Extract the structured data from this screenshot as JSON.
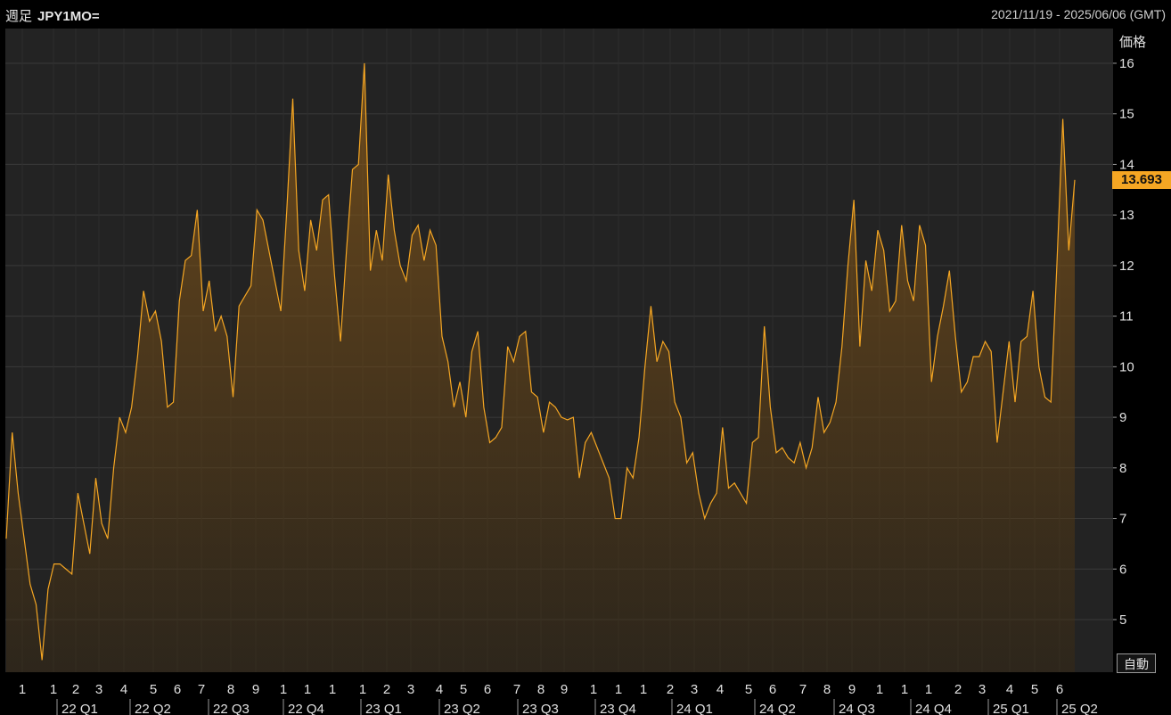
{
  "header": {
    "freq_label": "週足",
    "symbol": "JPY1MO=",
    "date_range": "2021/11/19 - 2025/06/06 (GMT)"
  },
  "price_axis_label": "価格",
  "auto_button": "自動",
  "last_value_badge": "13.693",
  "colors": {
    "line": "#f5a623",
    "background": "#232323",
    "grid": "#3a3a3a",
    "badge": "#f5a623"
  },
  "chart_data": {
    "type": "area",
    "ylim": [
      4.0,
      16.5
    ],
    "y_ticks": [
      5,
      6,
      7,
      8,
      9,
      10,
      11,
      12,
      13,
      14,
      15,
      16
    ],
    "last_value": 13.693,
    "x_month_ticks": [
      "1",
      "1",
      "2",
      "3",
      "4",
      "5",
      "6",
      "7",
      "8",
      "9",
      "1",
      "1",
      "1",
      "1",
      "2",
      "3",
      "4",
      "5",
      "6",
      "7",
      "8",
      "9",
      "1",
      "1",
      "1",
      "2",
      "3",
      "4",
      "5",
      "6",
      "7",
      "8",
      "9",
      "1",
      "1",
      "1",
      "2",
      "3",
      "4",
      "5",
      "6"
    ],
    "quarter_labels": [
      "22 Q1",
      "22 Q2",
      "22 Q3",
      "22 Q4",
      "23 Q1",
      "23 Q2",
      "23 Q3",
      "23 Q4",
      "24 Q1",
      "24 Q2",
      "24 Q3",
      "24 Q4",
      "25 Q1",
      "25 Q2"
    ],
    "values": [
      6.6,
      8.7,
      7.5,
      6.6,
      5.7,
      5.3,
      4.2,
      5.6,
      6.1,
      6.1,
      6.0,
      5.9,
      7.5,
      6.9,
      6.3,
      7.8,
      6.9,
      6.6,
      8.0,
      9.0,
      8.7,
      9.2,
      10.2,
      11.5,
      10.9,
      11.1,
      10.5,
      9.2,
      9.3,
      11.3,
      12.1,
      12.2,
      13.1,
      11.1,
      11.7,
      10.7,
      11.0,
      10.6,
      9.4,
      11.2,
      11.4,
      11.6,
      13.1,
      12.9,
      12.3,
      11.7,
      11.1,
      13.1,
      15.3,
      12.3,
      11.5,
      12.9,
      12.3,
      13.3,
      13.4,
      11.8,
      10.5,
      12.3,
      13.9,
      14.0,
      16.0,
      11.9,
      12.7,
      12.1,
      13.8,
      12.7,
      12.0,
      11.7,
      12.6,
      12.8,
      12.1,
      12.7,
      12.4,
      10.6,
      10.1,
      9.2,
      9.7,
      9.0,
      10.3,
      10.7,
      9.2,
      8.5,
      8.6,
      8.8,
      10.4,
      10.1,
      10.6,
      10.7,
      9.5,
      9.4,
      8.7,
      9.3,
      9.2,
      9.0,
      8.95,
      9.0,
      7.8,
      8.5,
      8.7,
      8.4,
      8.1,
      7.8,
      7.0,
      7.0,
      8.0,
      7.8,
      8.6,
      10.0,
      11.2,
      10.1,
      10.5,
      10.3,
      9.3,
      9.0,
      8.1,
      8.3,
      7.5,
      7.0,
      7.3,
      7.5,
      8.8,
      7.6,
      7.7,
      7.5,
      7.3,
      8.5,
      8.6,
      10.8,
      9.2,
      8.3,
      8.4,
      8.2,
      8.1,
      8.5,
      8.0,
      8.4,
      9.4,
      8.7,
      8.9,
      9.3,
      10.4,
      12.0,
      13.3,
      10.4,
      12.1,
      11.5,
      12.7,
      12.3,
      11.1,
      11.3,
      12.8,
      11.7,
      11.3,
      12.8,
      12.4,
      9.7,
      10.6,
      11.2,
      11.9,
      10.6,
      9.5,
      9.7,
      10.2,
      10.2,
      10.5,
      10.3,
      8.5,
      9.5,
      10.5,
      9.3,
      10.5,
      10.6,
      11.5,
      10.0,
      9.4,
      9.3,
      12.0,
      14.9,
      12.3,
      13.693
    ]
  }
}
